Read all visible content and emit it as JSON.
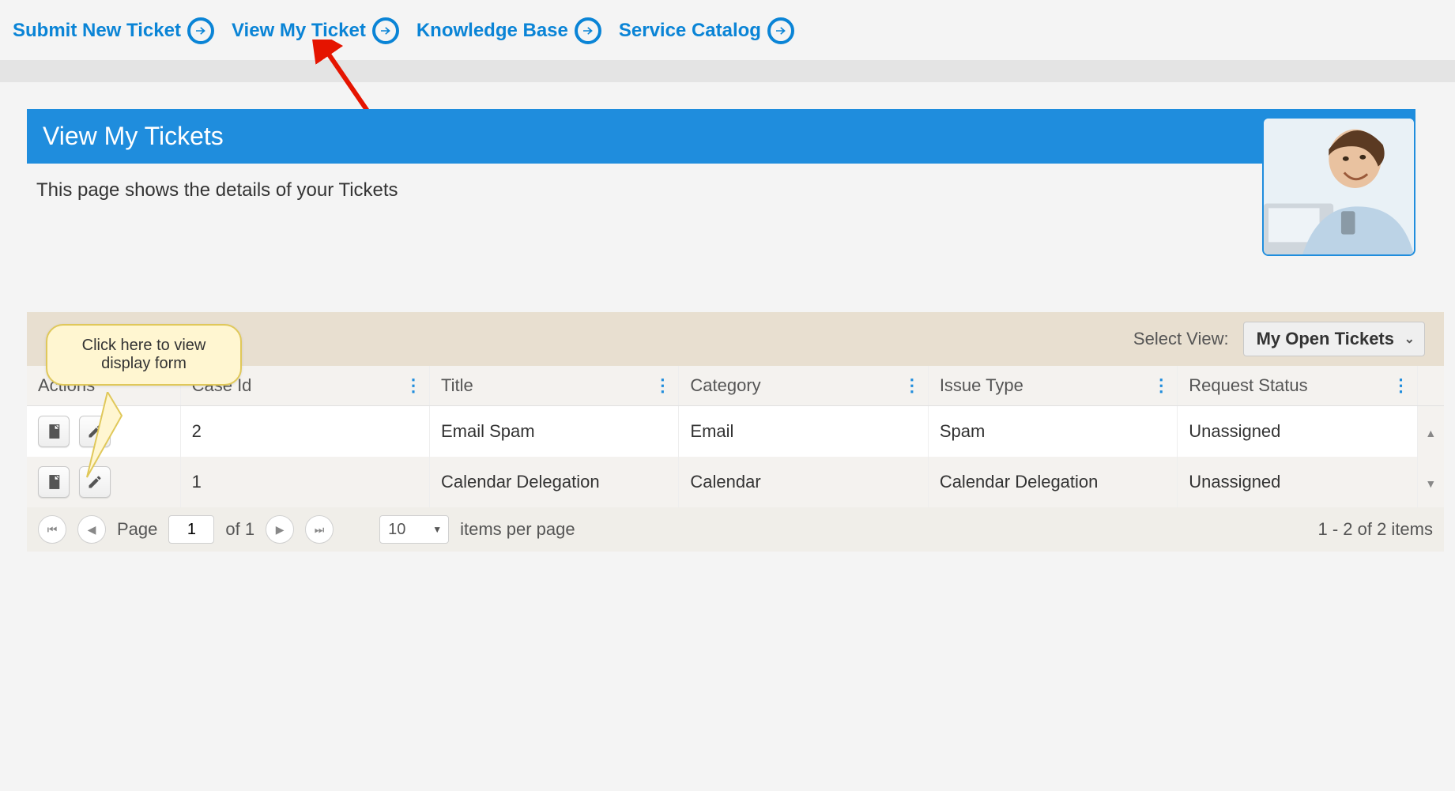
{
  "nav": {
    "items": [
      {
        "label": "Submit New Ticket"
      },
      {
        "label": "View My Ticket"
      },
      {
        "label": "Knowledge Base"
      },
      {
        "label": "Service Catalog"
      }
    ]
  },
  "page": {
    "title": "View My Tickets",
    "subtitle": "This page shows the details of your Tickets"
  },
  "callout": {
    "line1": "Click here to view",
    "line2": "display form"
  },
  "viewSelector": {
    "label": "Select View:",
    "selected": "My Open Tickets"
  },
  "columns": {
    "actions": "Actions",
    "caseId": "Case Id",
    "title": "Title",
    "category": "Category",
    "issueType": "Issue Type",
    "requestStatus": "Request Status"
  },
  "rows": [
    {
      "caseId": "2",
      "title": "Email Spam",
      "category": "Email",
      "issueType": "Spam",
      "requestStatus": "Unassigned"
    },
    {
      "caseId": "1",
      "title": "Calendar Delegation",
      "category": "Calendar",
      "issueType": "Calendar Delegation",
      "requestStatus": "Unassigned"
    }
  ],
  "pager": {
    "pageLabel": "Page",
    "pageValue": "1",
    "ofLabel": "of 1",
    "perPageValue": "10",
    "perPageLabel": "items per page",
    "summary": "1 - 2 of 2 items"
  },
  "colors": {
    "accent": "#1f8ddd",
    "link": "#0a84d6"
  }
}
